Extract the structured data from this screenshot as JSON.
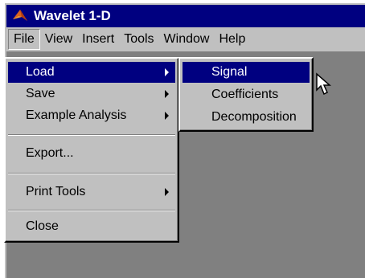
{
  "window": {
    "title": "Wavelet 1-D"
  },
  "menubar": {
    "items": [
      "File",
      "View",
      "Insert",
      "Tools",
      "Window",
      "Help"
    ]
  },
  "file_menu": {
    "items": [
      {
        "label": "Load",
        "submenu": true,
        "highlighted": true
      },
      {
        "label": "Save",
        "submenu": true
      },
      {
        "label": "Example Analysis",
        "submenu": true
      },
      {
        "label": "Export..."
      },
      {
        "label": "Print Tools",
        "submenu": true
      },
      {
        "label": "Close"
      }
    ]
  },
  "load_submenu": {
    "items": [
      {
        "label": "Signal",
        "highlighted": true
      },
      {
        "label": "Coefficients"
      },
      {
        "label": "Decomposition"
      }
    ]
  },
  "colors": {
    "menu_bg": "#c0c0c0",
    "highlight": "#000080",
    "titlebar": "#000080",
    "workspace": "#808080"
  },
  "icons": {
    "app": "matlab-icon",
    "cursor": "arrow-pointer-icon"
  }
}
